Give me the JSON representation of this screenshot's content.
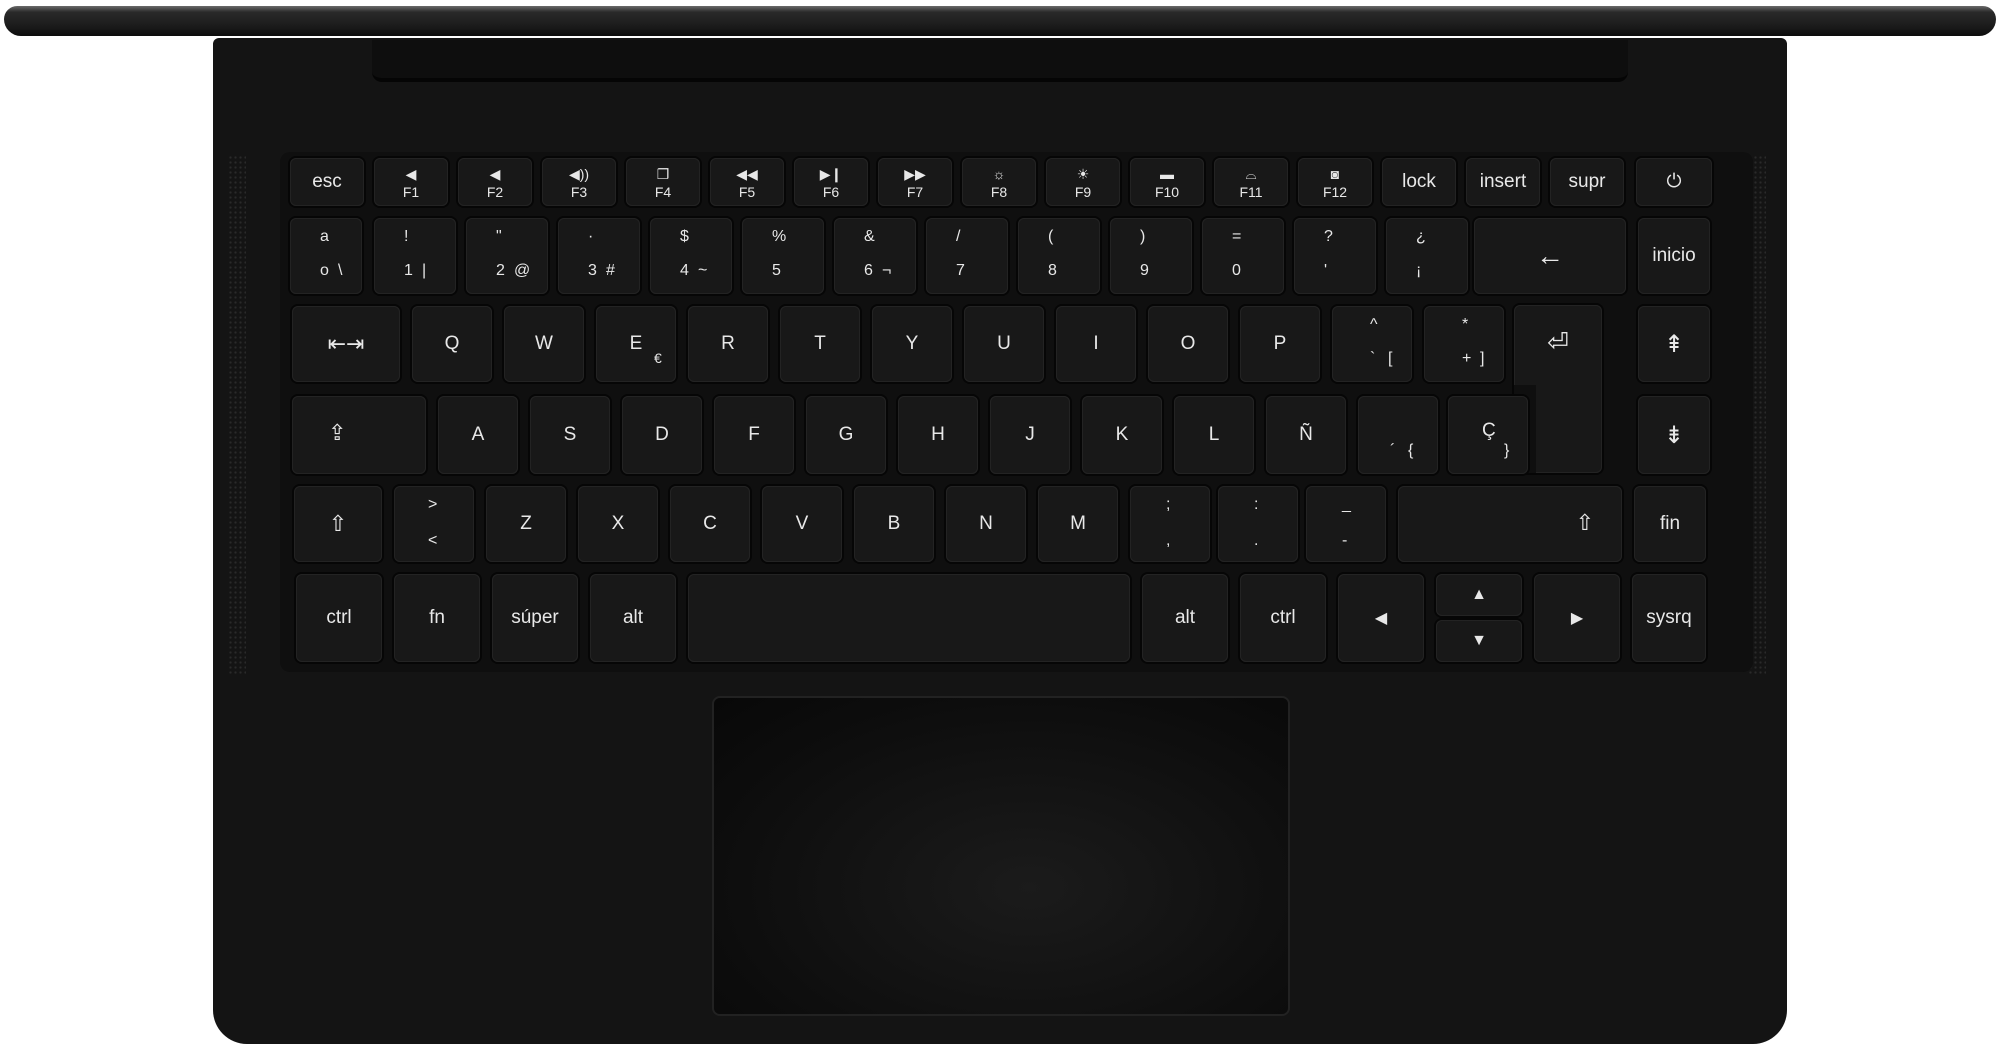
{
  "keyboard": {
    "fn_row": [
      {
        "label": "esc",
        "icon": ""
      },
      {
        "label": "F1",
        "icon": "◀"
      },
      {
        "label": "F2",
        "icon": "◀"
      },
      {
        "label": "F3",
        "icon": "◀))"
      },
      {
        "label": "F4",
        "icon": "❐"
      },
      {
        "label": "F5",
        "icon": "◀◀"
      },
      {
        "label": "F6",
        "icon": "▶❙"
      },
      {
        "label": "F7",
        "icon": "▶▶"
      },
      {
        "label": "F8",
        "icon": "☼"
      },
      {
        "label": "F9",
        "icon": "☀"
      },
      {
        "label": "F10",
        "icon": "▬"
      },
      {
        "label": "F11",
        "icon": "⌓"
      },
      {
        "label": "F12",
        "icon": "◙"
      },
      {
        "label": "lock",
        "icon": ""
      },
      {
        "label": "insert",
        "icon": ""
      },
      {
        "label": "supr",
        "icon": ""
      },
      {
        "label": "",
        "icon": "⏻"
      }
    ],
    "number_row": [
      {
        "top": "a",
        "bottom": "o",
        "right": "\\"
      },
      {
        "top": "!",
        "bottom": "1",
        "right": "|"
      },
      {
        "top": "\"",
        "bottom": "2",
        "right": "@"
      },
      {
        "top": "·",
        "bottom": "3",
        "right": "#"
      },
      {
        "top": "$",
        "bottom": "4",
        "right": "~"
      },
      {
        "top": "%",
        "bottom": "5",
        "right": ""
      },
      {
        "top": "&",
        "bottom": "6",
        "right": "¬"
      },
      {
        "top": "/",
        "bottom": "7",
        "right": ""
      },
      {
        "top": "(",
        "bottom": "8",
        "right": ""
      },
      {
        "top": ")",
        "bottom": "9",
        "right": ""
      },
      {
        "top": "=",
        "bottom": "0",
        "right": ""
      },
      {
        "top": "?",
        "bottom": "'",
        "right": ""
      },
      {
        "top": "¿",
        "bottom": "¡",
        "right": ""
      }
    ],
    "backspace_icon": "←",
    "inicio": "inicio",
    "tab_icon": "⇤⇥",
    "qwerty_row": [
      "Q",
      "W",
      "E",
      "R",
      "T",
      "Y",
      "U",
      "I",
      "O",
      "P"
    ],
    "e_alt": "€",
    "bracket_keys": [
      {
        "top": "^",
        "bottom": "`",
        "right": "["
      },
      {
        "top": "*",
        "bottom": "+",
        "right": "]"
      }
    ],
    "enter_icon": "⏎",
    "pgup_icon": "⇞",
    "caps_icon": "⇪",
    "asdf_row": [
      "A",
      "S",
      "D",
      "F",
      "G",
      "H",
      "J",
      "K",
      "L",
      "Ñ"
    ],
    "acute_key": {
      "bottom": "´",
      "right": "{"
    },
    "cedilla_key": {
      "top": "Ç",
      "right": "}"
    },
    "pgdn_icon": "⇟",
    "shift_icon": "⇧",
    "angle_key": {
      "top": ">",
      "bottom": "<"
    },
    "zxcv_row": [
      "Z",
      "X",
      "C",
      "V",
      "B",
      "N",
      "M"
    ],
    "punct_keys": [
      {
        "top": ";",
        "bottom": ","
      },
      {
        "top": ":",
        "bottom": "."
      },
      {
        "top": "_",
        "bottom": "-"
      }
    ],
    "fin": "fin",
    "bottom_row": {
      "ctrl_left": "ctrl",
      "fn": "fn",
      "super": "súper",
      "alt_left": "alt",
      "alt_right": "alt",
      "ctrl_right": "ctrl",
      "sysrq": "sysrq"
    },
    "arrows": {
      "left": "◀",
      "up": "▲",
      "down": "▼",
      "right": "▶"
    }
  }
}
